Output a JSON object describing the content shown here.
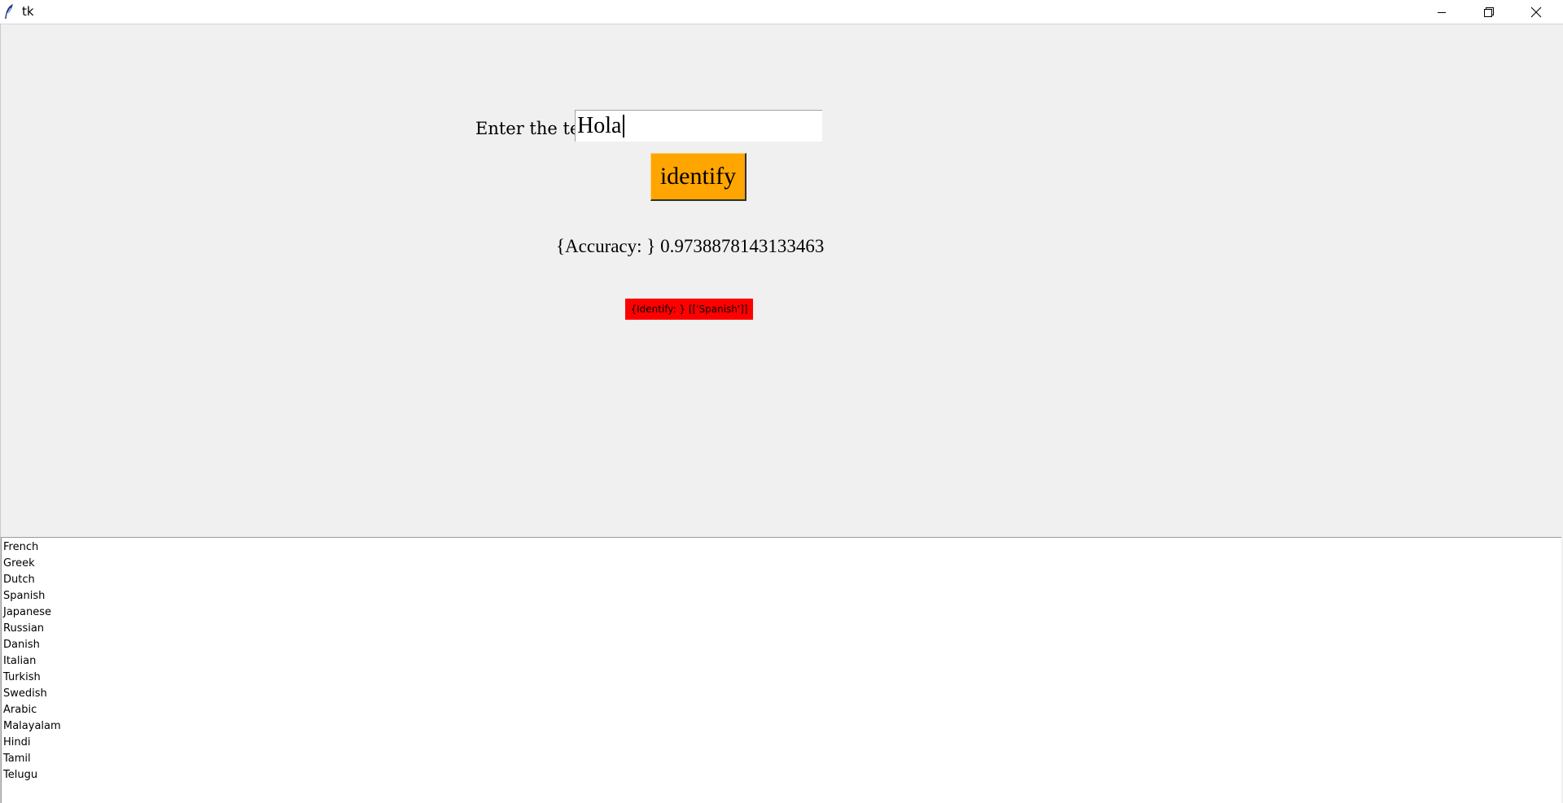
{
  "window": {
    "title": "tk",
    "icons": {
      "app": "feather-icon",
      "minimize": "minimize-icon",
      "maximize": "restore-icon",
      "close": "close-icon"
    }
  },
  "form": {
    "label": "Enter the text",
    "input_value": "Hola",
    "button_label": "identify",
    "button_color": "#ffa500"
  },
  "output": {
    "accuracy": "{Accuracy: } 0.9738878143133463",
    "result": "{Identify: } [['Spanish']]",
    "result_color": "#ff0000"
  },
  "languages": [
    "French",
    "Greek",
    "Dutch",
    "Spanish",
    "Japanese",
    "Russian",
    "Danish",
    "Italian",
    "Turkish",
    "Swedish",
    "Arabic",
    "Malayalam",
    "Hindi",
    "Tamil",
    "Telugu"
  ]
}
